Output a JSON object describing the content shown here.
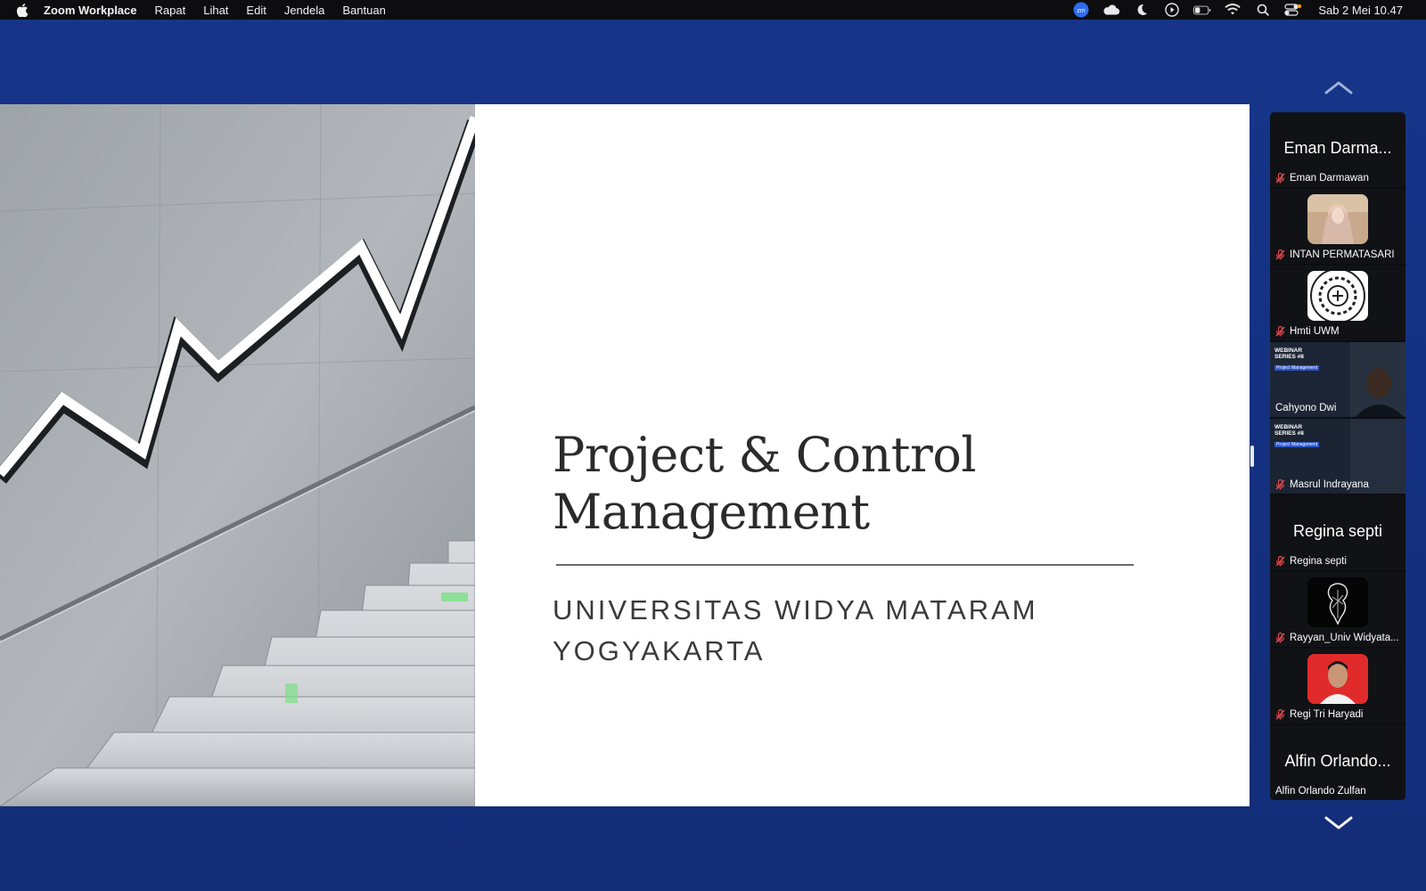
{
  "menubar": {
    "app_name": "Zoom Workplace",
    "menus": [
      "Rapat",
      "Lihat",
      "Edit",
      "Jendela",
      "Bantuan"
    ],
    "status_icons": [
      "zoom-icon",
      "cloud-icon",
      "moon-icon",
      "play-icon",
      "battery-icon",
      "wifi-icon",
      "search-icon",
      "control-center-icon"
    ],
    "clock": "Sab 2 Mei  10.47"
  },
  "slide": {
    "title_line1": "Project & Control",
    "title_line2": "Management",
    "subtitle_line1": "UNIVERSITAS WIDYA MATARAM",
    "subtitle_line2": "YOGYAKARTA"
  },
  "gallery": {
    "participants": [
      {
        "display": "Eman Darma...",
        "name": "Eman Darmawan",
        "muted": true,
        "kind": "name"
      },
      {
        "name": "INTAN PERMATASARI",
        "muted": true,
        "kind": "photo"
      },
      {
        "name": "Hmti UWM",
        "muted": true,
        "kind": "logo"
      },
      {
        "name": "Cahyono Dwi",
        "muted": false,
        "kind": "video",
        "active": true
      },
      {
        "name": "Masrul Indrayana",
        "muted": true,
        "kind": "video"
      },
      {
        "display": "Regina septi",
        "name": "Regina septi",
        "muted": true,
        "kind": "name"
      },
      {
        "name": "Rayyan_Univ Widyata...",
        "muted": true,
        "kind": "photo-dark"
      },
      {
        "name": "Regi Tri Haryadi",
        "muted": true,
        "kind": "photo-red"
      },
      {
        "display": "Alfin Orlando...",
        "name": "Alfin Orlando Zulfan",
        "muted": false,
        "kind": "name"
      }
    ],
    "webinar_badge": "WEBINAR SERIES #8",
    "webinar_tag": "Project Management"
  },
  "colors": {
    "window_bg": "#16358a",
    "active_speaker": "#34c759",
    "muted_icon": "#e5484d"
  }
}
